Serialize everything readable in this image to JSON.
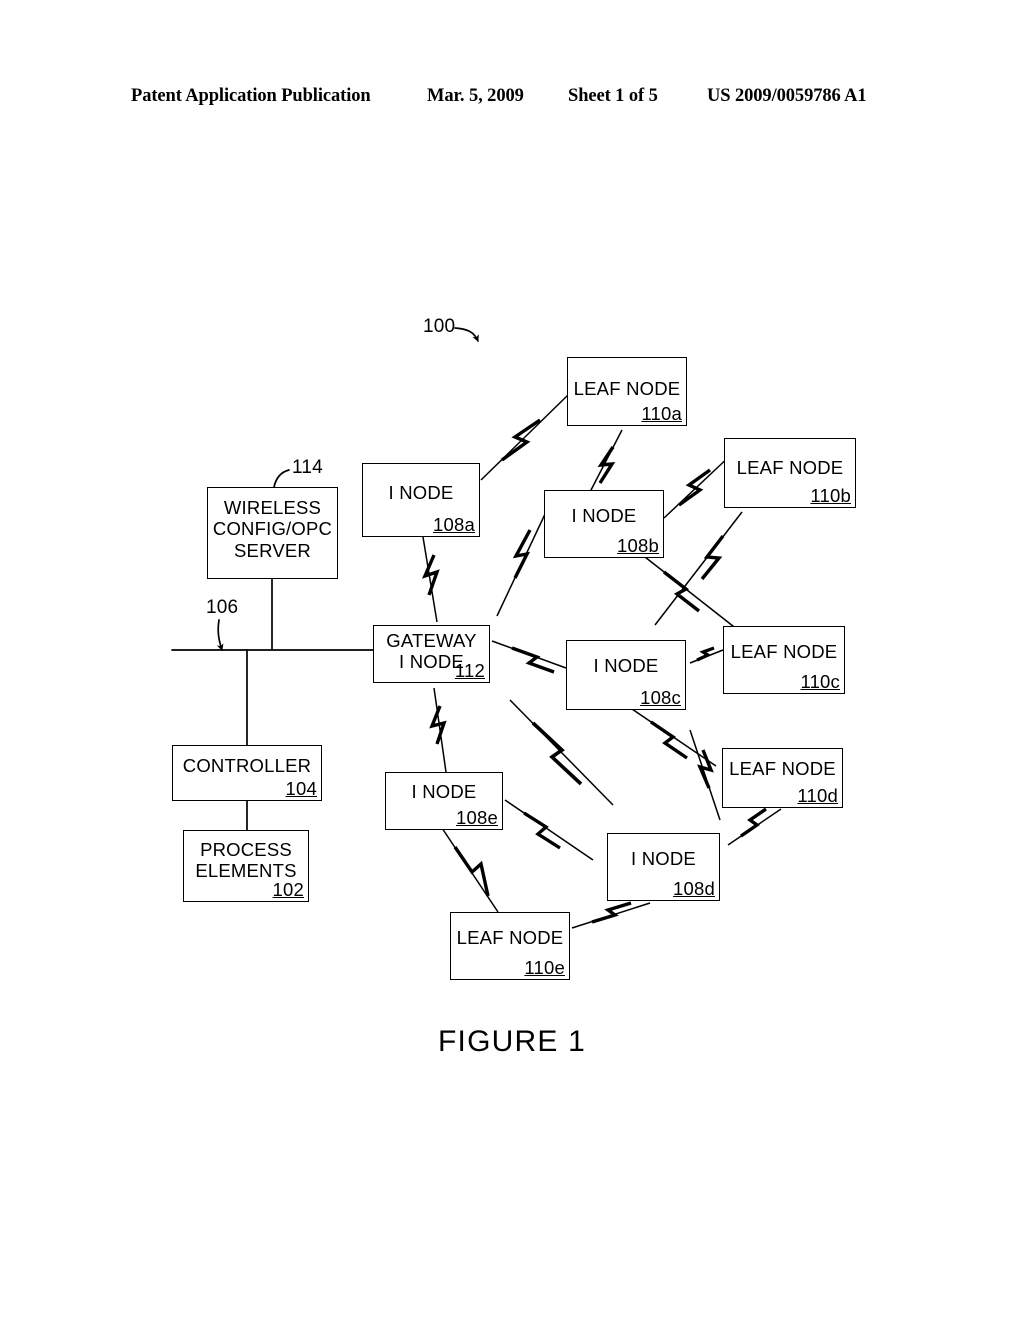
{
  "header": {
    "publication": "Patent Application Publication",
    "date": "Mar. 5, 2009",
    "sheet": "Sheet 1 of 5",
    "doc_number": "US 2009/0059786 A1"
  },
  "figure": {
    "caption": "FIGURE 1",
    "system_ref": "100"
  },
  "lead_labels": {
    "system": "100",
    "server_ref": "114",
    "bus_ref": "106"
  },
  "nodes": {
    "server": {
      "title": "WIRELESS\nCONFIG/OPC\nSERVER",
      "ref": ""
    },
    "controller": {
      "title": "CONTROLLER",
      "ref": "104"
    },
    "process": {
      "title": "PROCESS\nELEMENTS",
      "ref": "102"
    },
    "gateway": {
      "title": "GATEWAY\nI NODE",
      "ref": "112"
    },
    "inode_a": {
      "title": "I NODE",
      "ref": "108a"
    },
    "inode_b": {
      "title": "I NODE",
      "ref": "108b"
    },
    "inode_c": {
      "title": "I NODE",
      "ref": "108c"
    },
    "inode_d": {
      "title": "I NODE",
      "ref": "108d"
    },
    "inode_e": {
      "title": "I NODE",
      "ref": "108e"
    },
    "leaf_a": {
      "title": "LEAF NODE",
      "ref": "110a"
    },
    "leaf_b": {
      "title": "LEAF NODE",
      "ref": "110b"
    },
    "leaf_c": {
      "title": "LEAF NODE",
      "ref": "110c"
    },
    "leaf_d": {
      "title": "LEAF NODE",
      "ref": "110d"
    },
    "leaf_e": {
      "title": "LEAF NODE",
      "ref": "110e"
    }
  },
  "colors": {
    "ink": "#000000",
    "paper": "#ffffff"
  }
}
